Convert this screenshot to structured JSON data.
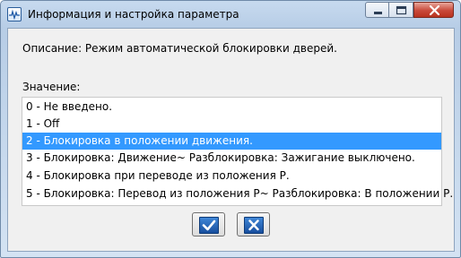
{
  "window": {
    "title": "Информация и настройка параметра"
  },
  "description": "Описание: Режим автоматической блокировки дверей.",
  "value_label": "Значение:",
  "options": [
    {
      "label": "0 - Не введено.",
      "selected": false
    },
    {
      "label": "1 - Off",
      "selected": false
    },
    {
      "label": "2 - Блокировка в положении движения.",
      "selected": true
    },
    {
      "label": "3 - Блокировка: Движение~ Разблокировка: Зажигание выключено.",
      "selected": false
    },
    {
      "label": "4 - Блокировка при переводе из положения Р.",
      "selected": false
    },
    {
      "label": "5 - Блокировка: Перевод из положения Р~ Разблокировка: В положении Р.",
      "selected": false
    }
  ],
  "buttons": {
    "ok_icon": "checkmark-icon",
    "cancel_icon": "x-icon"
  },
  "colors": {
    "selection": "#3399ff",
    "button_glyph": "#2a6bc0",
    "close_button": "#c9493a"
  }
}
